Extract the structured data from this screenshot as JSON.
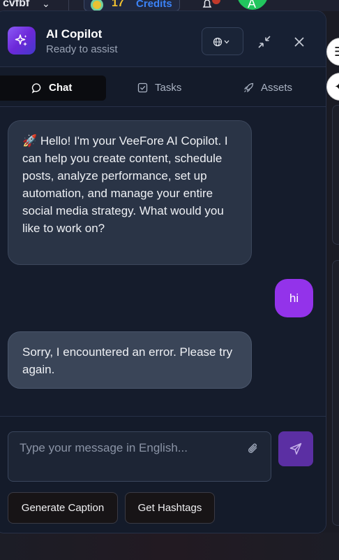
{
  "background": {
    "workspace_name": "cvfbf",
    "credits_count": "17",
    "credits_label": "Credits",
    "avatar_letter": "A"
  },
  "copilot": {
    "title": "AI Copilot",
    "status": "Ready to assist",
    "tabs": [
      {
        "label": "Chat",
        "icon": "chat-bubble-icon",
        "active": true
      },
      {
        "label": "Tasks",
        "icon": "checkbox-icon",
        "active": false
      },
      {
        "label": "Assets",
        "icon": "rocket-icon",
        "active": false
      }
    ],
    "messages": [
      {
        "role": "assistant",
        "text": "🚀 Hello! I'm your VeeFore AI Copilot. I can help you create content, schedule posts, analyze performance, set up automation, and manage your entire social media strategy. What would you like to work on?"
      },
      {
        "role": "user",
        "text": "hi"
      },
      {
        "role": "assistant",
        "text": "Sorry, I encountered an error. Please try again."
      }
    ],
    "input": {
      "placeholder": "Type your message in English...",
      "value": ""
    },
    "quick_actions": [
      "Generate Caption",
      "Get Hashtags"
    ]
  },
  "colors": {
    "accent": "#9333ea",
    "panel_bg": "#151c2c",
    "bubble_bg": "#2a3446"
  }
}
